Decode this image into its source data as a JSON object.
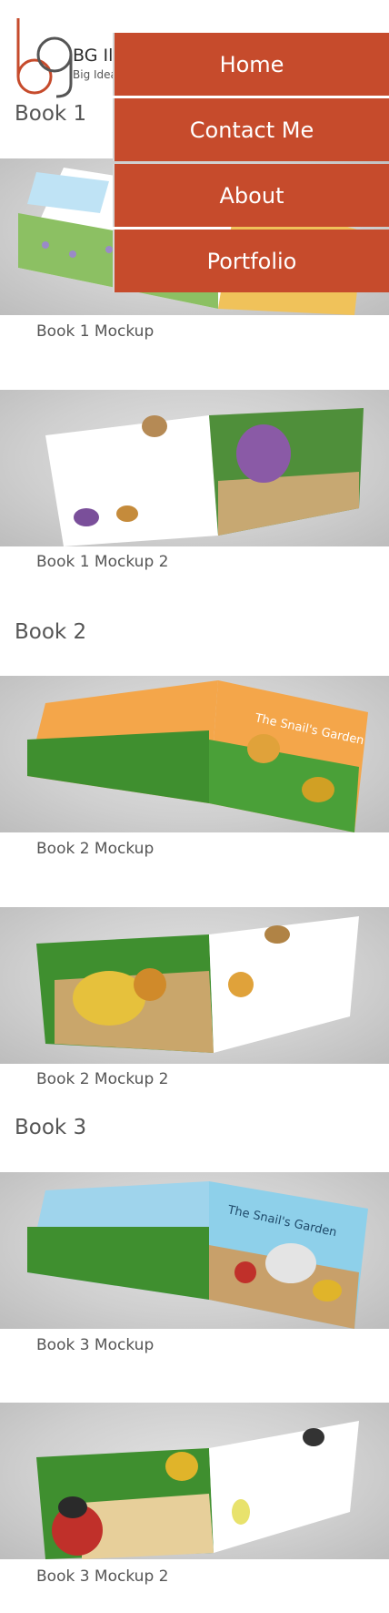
{
  "site": {
    "brand_name": "BG Illustrations",
    "brand_sub": "Big Ideas"
  },
  "menu": {
    "items": [
      {
        "label": "Home"
      },
      {
        "label": "Contact Me"
      },
      {
        "label": "About"
      },
      {
        "label": "Portfolio"
      }
    ]
  },
  "books": [
    {
      "heading": "Book 1",
      "mockups": [
        {
          "caption": "Book 1 Mockup",
          "cover_text": ""
        },
        {
          "caption": "Book 1 Mockup 2",
          "cover_text": ""
        }
      ]
    },
    {
      "heading": "Book 2",
      "mockups": [
        {
          "caption": "Book 2 Mockup",
          "cover_text": "The Snail's Garden"
        },
        {
          "caption": "Book 2 Mockup 2",
          "cover_text": ""
        }
      ]
    },
    {
      "heading": "Book 3",
      "mockups": [
        {
          "caption": "Book 3 Mockup",
          "cover_text": "The Snail's Garden"
        },
        {
          "caption": "Book 3 Mockup 2",
          "cover_text": ""
        }
      ]
    }
  ],
  "colors": {
    "accent": "#c64b2c",
    "heading_text": "#555555"
  }
}
